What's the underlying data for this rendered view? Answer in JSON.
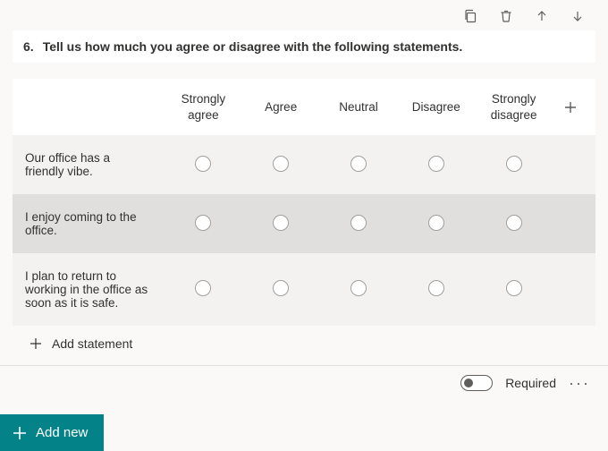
{
  "toolbar": {
    "copy": "copy",
    "delete": "delete",
    "moveUp": "move up",
    "moveDown": "move down"
  },
  "question": {
    "number": "6.",
    "text": "Tell us how much you agree or disagree with the following statements.",
    "columns": [
      "Strongly agree",
      "Agree",
      "Neutral",
      "Disagree",
      "Strongly disagree"
    ],
    "rows": [
      "Our office has a friendly vibe.",
      "I enjoy coming to the office.",
      "I plan to return to working in the office as soon as it is safe."
    ],
    "addStatement": "Add statement"
  },
  "footer": {
    "requiredLabel": "Required",
    "requiredOn": false
  },
  "addNew": "Add new"
}
